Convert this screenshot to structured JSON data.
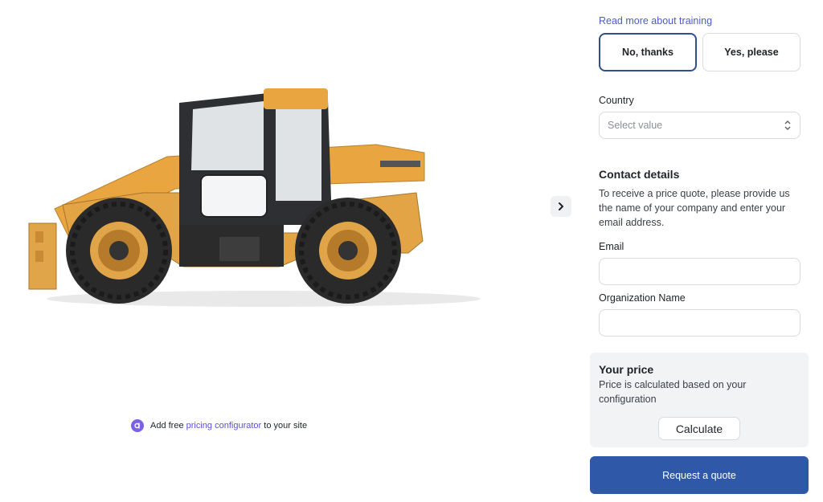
{
  "product": {
    "image_alt": "telehandler-image"
  },
  "navigation": {
    "next_icon": "chevron-right-icon"
  },
  "promo": {
    "prefix": "Add free ",
    "link_text": "pricing configurator",
    "suffix": " to your site",
    "logo_icon": "configurator-logo-icon"
  },
  "training": {
    "link_text": "Read more about training",
    "options": [
      {
        "label": "No, thanks",
        "selected": true
      },
      {
        "label": "Yes, please",
        "selected": false
      }
    ]
  },
  "country": {
    "label": "Country",
    "placeholder": "Select value",
    "icon": "select-chevrons-icon"
  },
  "contact": {
    "title": "Contact details",
    "description": "To receive a price quote, please provide us the name of your company and enter your email address.",
    "email_label": "Email",
    "email_value": "",
    "org_label": "Organization Name",
    "org_value": ""
  },
  "price": {
    "title": "Your price",
    "description": "Price is calculated based on your configuration",
    "calculate_label": "Calculate"
  },
  "quote": {
    "button_label": "Request a quote"
  },
  "colors": {
    "accent": "#2f58a8",
    "link": "#4a5bd1",
    "machine_body": "#e8a540"
  }
}
